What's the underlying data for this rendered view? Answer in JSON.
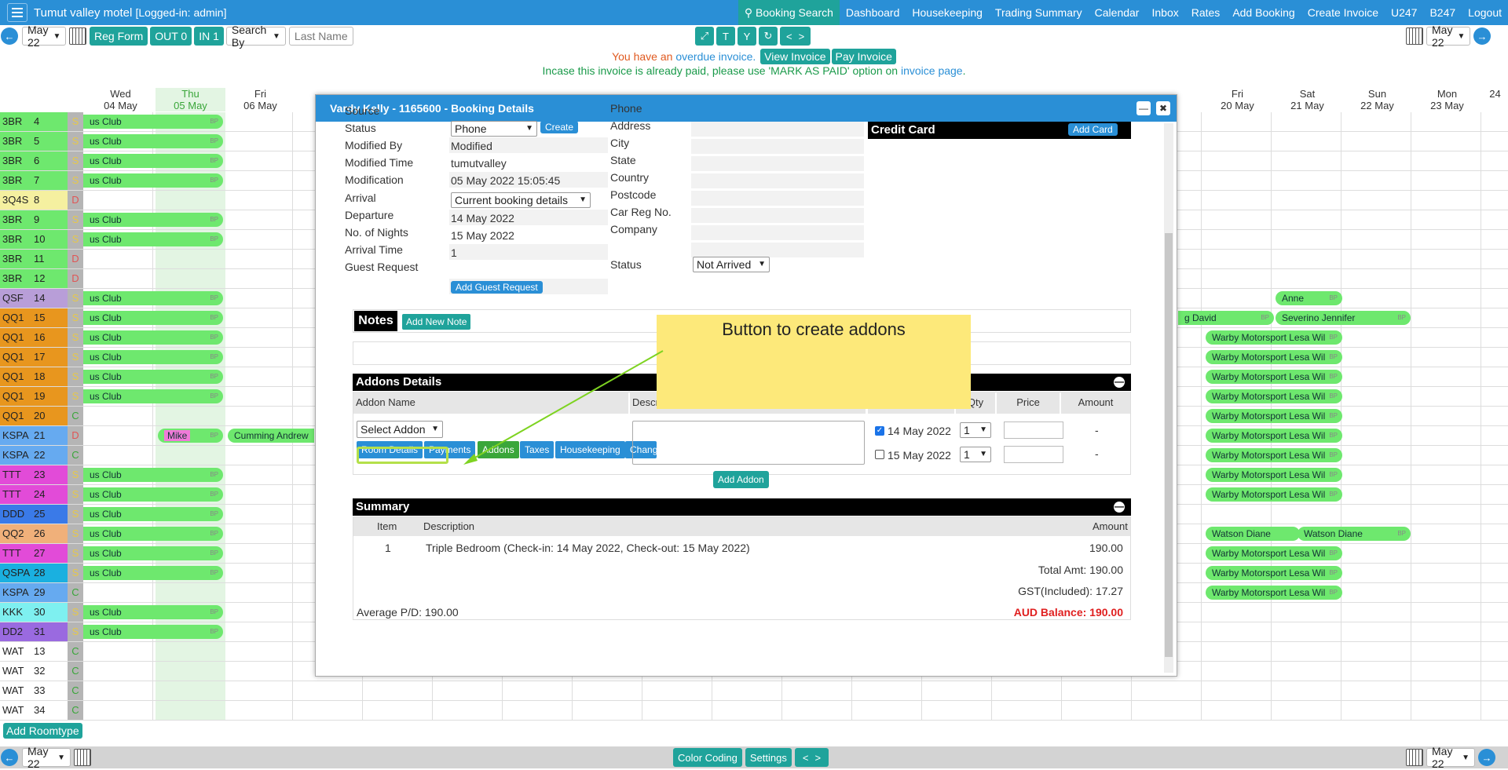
{
  "header": {
    "app_title": "Tumut valley motel",
    "login": "[Logged-in: admin]",
    "nav": [
      "Booking Search",
      "Dashboard",
      "Housekeeping",
      "Trading Summary",
      "Calendar",
      "Inbox",
      "Rates",
      "Add Booking",
      "Create Invoice",
      "U247",
      "B247",
      "Logout"
    ]
  },
  "toolbar": {
    "date_select": "May 22",
    "reg_form": "Reg Form",
    "out": "OUT 0",
    "in": "IN 1",
    "search_by": "Search By",
    "last_name_placeholder": "Last Name",
    "view_buttons": [
      "T",
      "Y"
    ],
    "prev": "<",
    "next": ">"
  },
  "notice": {
    "line1_pre": "You have an",
    "line1_link": "overdue invoice.",
    "view_invoice": "View Invoice",
    "pay_invoice": "Pay Invoice",
    "line2_pre": "Incase this invoice is already paid, please use 'MARK AS PAID' option on",
    "line2_link": "invoice page",
    "line2_post": "."
  },
  "days": [
    {
      "dow": "Wed",
      "date": "04 May"
    },
    {
      "dow": "Thu",
      "date": "05 May"
    },
    {
      "dow": "Fri",
      "date": "06 May"
    },
    {
      "dow": "Fri",
      "date": "20 May"
    },
    {
      "dow": "Sat",
      "date": "21 May"
    },
    {
      "dow": "Sun",
      "date": "22 May"
    },
    {
      "dow": "Mon",
      "date": "23 May"
    },
    {
      "dow": "",
      "date": "24"
    }
  ],
  "rooms": [
    {
      "type": "3BR",
      "num": "4",
      "st": "S",
      "color": "#6ee86e"
    },
    {
      "type": "3BR",
      "num": "5",
      "st": "S",
      "color": "#6ee86e"
    },
    {
      "type": "3BR",
      "num": "6",
      "st": "S",
      "color": "#6ee86e"
    },
    {
      "type": "3BR",
      "num": "7",
      "st": "S",
      "color": "#6ee86e"
    },
    {
      "type": "3Q4S",
      "num": "8",
      "st": "D",
      "color": "#f5f0a0"
    },
    {
      "type": "3BR",
      "num": "9",
      "st": "S",
      "color": "#6ee86e"
    },
    {
      "type": "3BR",
      "num": "10",
      "st": "S",
      "color": "#6ee86e"
    },
    {
      "type": "3BR",
      "num": "11",
      "st": "D",
      "color": "#6ee86e"
    },
    {
      "type": "3BR",
      "num": "12",
      "st": "D",
      "color": "#6ee86e"
    },
    {
      "type": "QSF",
      "num": "14",
      "st": "S",
      "color": "#b89ed8"
    },
    {
      "type": "QQ1",
      "num": "15",
      "st": "S",
      "color": "#e8961e"
    },
    {
      "type": "QQ1",
      "num": "16",
      "st": "S",
      "color": "#e8961e"
    },
    {
      "type": "QQ1",
      "num": "17",
      "st": "S",
      "color": "#e8961e"
    },
    {
      "type": "QQ1",
      "num": "18",
      "st": "S",
      "color": "#e8961e"
    },
    {
      "type": "QQ1",
      "num": "19",
      "st": "S",
      "color": "#e8961e"
    },
    {
      "type": "QQ1",
      "num": "20",
      "st": "C",
      "color": "#e8961e"
    },
    {
      "type": "KSPA",
      "num": "21",
      "st": "D",
      "color": "#66aaf0"
    },
    {
      "type": "KSPA",
      "num": "22",
      "st": "C",
      "color": "#66aaf0"
    },
    {
      "type": "TTT",
      "num": "23",
      "st": "S",
      "color": "#e24bd8"
    },
    {
      "type": "TTT",
      "num": "24",
      "st": "S",
      "color": "#e24bd8"
    },
    {
      "type": "DDD",
      "num": "25",
      "st": "S",
      "color": "#3a7ae8"
    },
    {
      "type": "QQ2",
      "num": "26",
      "st": "S",
      "color": "#f0b07a"
    },
    {
      "type": "TTT",
      "num": "27",
      "st": "S",
      "color": "#e24bd8"
    },
    {
      "type": "QSPA",
      "num": "28",
      "st": "S",
      "color": "#1ab0e0"
    },
    {
      "type": "KSPA",
      "num": "29",
      "st": "C",
      "color": "#66aaf0"
    },
    {
      "type": "KKK",
      "num": "30",
      "st": "S",
      "color": "#7ef0f0"
    },
    {
      "type": "DD2",
      "num": "31",
      "st": "S",
      "color": "#9a6ae0"
    },
    {
      "type": "WAT",
      "num": "13",
      "st": "C",
      "color": "#ffffff"
    },
    {
      "type": "WAT",
      "num": "32",
      "st": "C",
      "color": "#ffffff"
    },
    {
      "type": "WAT",
      "num": "33",
      "st": "C",
      "color": "#ffffff"
    },
    {
      "type": "WAT",
      "num": "34",
      "st": "C",
      "color": "#ffffff"
    }
  ],
  "bookings": {
    "club": "us Club",
    "bp": "BP",
    "mike": "Mike",
    "cumming": "Cumming Andrew",
    "anne": "Anne",
    "david": "g David",
    "severino": "Severino Jennifer",
    "warby": "Warby Motorsport Lesa Wil",
    "watson1": "Watson Diane",
    "watson2": "Watson Diane"
  },
  "add_roomtype": "Add Roomtype",
  "bottom": {
    "color_coding": "Color Coding",
    "settings": "Settings",
    "prev": "<",
    "next": ">",
    "date_select": "May 22"
  },
  "modal": {
    "title": "Vardy Kelly - 1165600 - Booking Details",
    "left_labels": [
      "Source",
      "Status",
      "Modified By",
      "Modified Time",
      "Modification",
      "Arrival",
      "Departure",
      "No. of Nights",
      "Arrival Time",
      "Guest Request"
    ],
    "source_value": "Phone",
    "create_btn": "Create",
    "status": "Modified",
    "modified_by": "tumutvalley",
    "modified_time": "05 May 2022 15:05:45",
    "modification": "Current booking details",
    "arrival": "14 May 2022",
    "departure": "15 May 2022",
    "nights": "1",
    "arrival_time": "",
    "guest_request_btn": "Add Guest Request",
    "mid_labels": [
      "Phone",
      "Address",
      "City",
      "State",
      "Country",
      "Postcode",
      "Car Reg No.",
      "Company",
      "Status"
    ],
    "guest_status": "Not Arrived",
    "credit_card": "Credit Card",
    "add_card": "Add Card",
    "notes": "Notes",
    "add_note": "Add New Note",
    "tabs": [
      "Room Details",
      "Payments",
      "Addons",
      "Taxes",
      "Housekeeping",
      "Chang"
    ],
    "addons_title": "Addons Details",
    "addon_cols": [
      "Addon Name",
      "Descrip",
      "Qty",
      "Price",
      "Amount"
    ],
    "select_addon": "Select Addon",
    "dates": [
      "14 May 2022",
      "15 May 2022"
    ],
    "qty": [
      "1",
      "1"
    ],
    "amount": [
      "-",
      "-"
    ],
    "add_addon": "Add Addon",
    "summary_title": "Summary",
    "sum_cols": [
      "Item",
      "Description",
      "Amount"
    ],
    "sum_item": "1",
    "sum_desc": "Triple Bedroom (Check-in: 14 May 2022, Check-out: 15 May 2022)",
    "sum_amount": "190.00",
    "total": "Total Amt: 190.00",
    "gst": "GST(Included): 17.27",
    "avg": "Average P/D: 190.00",
    "balance": "AUD Balance: 190.00"
  },
  "annotation": "Button to create addons",
  "colors": {
    "accent": "#2a8fd6",
    "teal": "#1fa39b",
    "booking": "#6ee86e",
    "note": "#fde97a"
  }
}
